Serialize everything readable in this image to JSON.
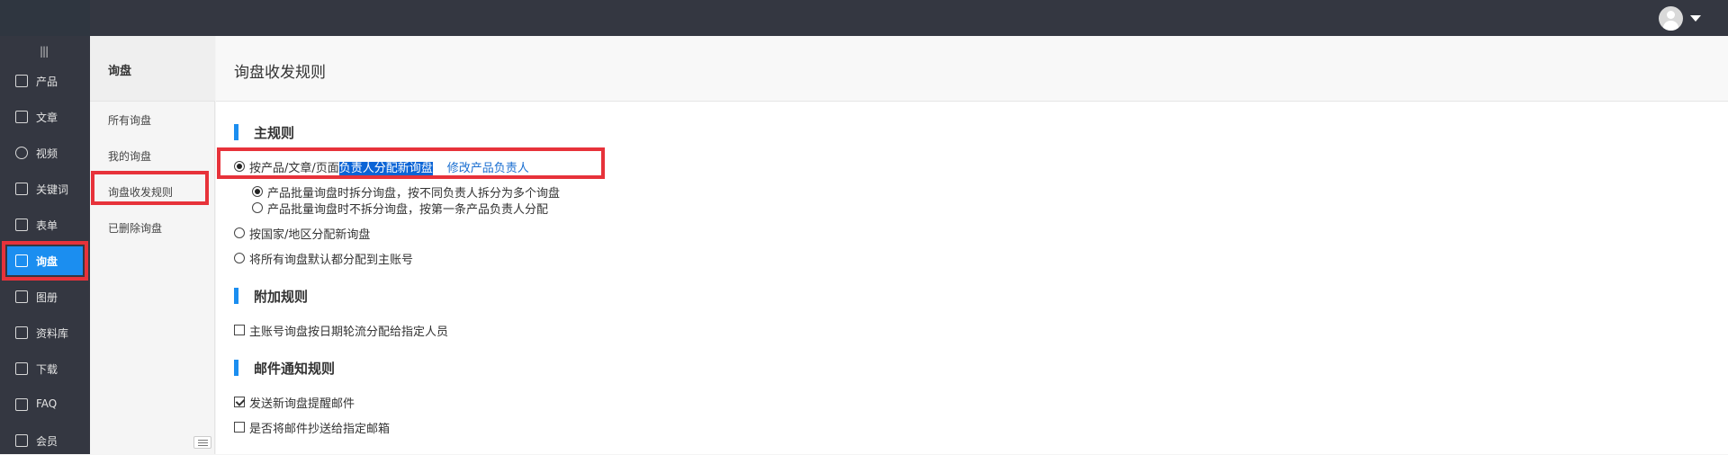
{
  "topbar": {
    "avatar_icon": "user-avatar-icon",
    "dropdown_icon": "caret-down-icon"
  },
  "nav": {
    "collapse_label": "|||",
    "items": [
      {
        "label": "产品",
        "icon": "grid-icon"
      },
      {
        "label": "文章",
        "icon": "document-icon"
      },
      {
        "label": "视频",
        "icon": "play-icon"
      },
      {
        "label": "关键词",
        "icon": "keyword-icon"
      },
      {
        "label": "表单",
        "icon": "clipboard-icon"
      },
      {
        "label": "询盘",
        "icon": "inquiry-icon",
        "active": true
      },
      {
        "label": "图册",
        "icon": "gallery-icon"
      },
      {
        "label": "资料库",
        "icon": "database-icon"
      },
      {
        "label": "下载",
        "icon": "download-icon"
      },
      {
        "label": "FAQ",
        "icon": "question-icon"
      },
      {
        "label": "会员",
        "icon": "crown-icon"
      }
    ]
  },
  "subnav": {
    "title": "询盘",
    "items": [
      "所有询盘",
      "我的询盘",
      "询盘收发规则",
      "已删除询盘"
    ]
  },
  "main": {
    "title": "询盘收发规则",
    "main_rules": {
      "title": "主规则",
      "option1_prefix": "按产品/文章/页面",
      "option1_highlight": "负责人分配新询盘",
      "option1_link": "修改产品负责人",
      "sub_option1": "产品批量询盘时拆分询盘，按不同负责人拆分为多个询盘",
      "sub_option2": "产品批量询盘时不拆分询盘，按第一条产品负责人分配",
      "option2": "按国家/地区分配新询盘",
      "option3": "将所有询盘默认都分配到主账号"
    },
    "extra_rules": {
      "title": "附加规则",
      "option1": "主账号询盘按日期轮流分配给指定人员"
    },
    "mail_rules": {
      "title": "邮件通知规则",
      "option1": "发送新询盘提醒邮件",
      "option2": "是否将邮件抄送给指定邮箱"
    }
  },
  "colors": {
    "accent": "#1b8ef0",
    "highlight_box": "#e7323a",
    "nav_bg": "#343741"
  }
}
